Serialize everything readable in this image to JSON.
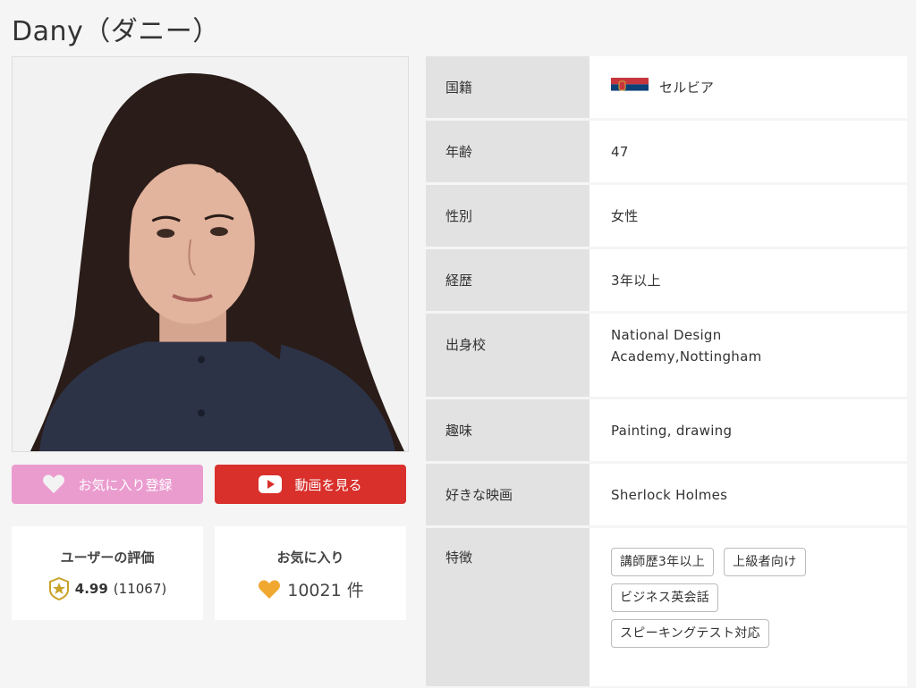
{
  "profile": {
    "name": "Dany（ダニー）"
  },
  "buttons": {
    "favorite_label": "お気に入り登録",
    "video_label": "動画を見る"
  },
  "stats": {
    "rating_label": "ユーザーの評価",
    "rating_value": "4.99",
    "rating_count": "(11067)",
    "favorites_label": "お気に入り",
    "favorites_value": "10021 件"
  },
  "details": {
    "nationality_label": "国籍",
    "nationality_value": "セルビア",
    "age_label": "年齢",
    "age_value": "47",
    "gender_label": "性別",
    "gender_value": "女性",
    "experience_label": "経歴",
    "experience_value": "3年以上",
    "school_label": "出身校",
    "school_value_line1": "National Design",
    "school_value_line2": "Academy,Nottingham",
    "hobby_label": "趣味",
    "hobby_value": "Painting, drawing",
    "movie_label": "好きな映画",
    "movie_value": "Sherlock Holmes",
    "features_label": "特徴",
    "features": [
      "講師歴3年以上",
      "上級者向け",
      "ビジネス英会話",
      "スピーキングテスト対応"
    ]
  },
  "colors": {
    "favorite_button": "#eb9ccf",
    "video_button": "#d9302c",
    "label_cell": "#e2e2e2",
    "rating_star": "#c9a227",
    "heart_orange": "#f0a830"
  },
  "icons": {
    "favorite_button_icon": "heart-icon",
    "video_button_icon": "play-icon",
    "rating_icon": "star-badge-icon",
    "favorites_icon": "heart-icon",
    "flag": "serbia-flag-icon"
  }
}
